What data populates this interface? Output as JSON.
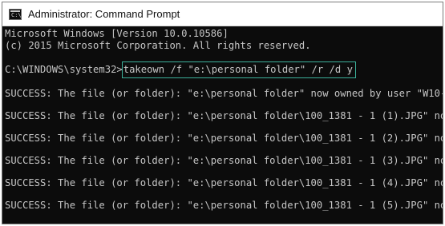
{
  "window": {
    "title": "Administrator: Command Prompt",
    "icon": "command-prompt-icon",
    "icon_glyph": "C:\\"
  },
  "console": {
    "header_line1": "Microsoft Windows [Version 10.0.10586]",
    "header_line2": "(c) 2015 Microsoft Corporation. All rights reserved.",
    "prompt": "C:\\WINDOWS\\system32>",
    "command": "takeown /f \"e:\\personal folder\" /r /d y",
    "output": [
      "SUCCESS: The file (or folder): \"e:\\personal folder\" now owned by user \"W10-",
      "SUCCESS: The file (or folder): \"e:\\personal folder\\100_1381 - 1 (1).JPG\" no",
      "SUCCESS: The file (or folder): \"e:\\personal folder\\100_1381 - 1 (2).JPG\" no",
      "SUCCESS: The file (or folder): \"e:\\personal folder\\100_1381 - 1 (3).JPG\" no",
      "SUCCESS: The file (or folder): \"e:\\personal folder\\100_1381 - 1 (4).JPG\" no",
      "SUCCESS: The file (or folder): \"e:\\personal folder\\100_1381 - 1 (5).JPG\" no"
    ]
  },
  "colors": {
    "console_background": "#0c0c0c",
    "console_text": "#c6c6c6",
    "command_highlight_border": "#3cb19b",
    "titlebar_background": "#ffffff"
  }
}
